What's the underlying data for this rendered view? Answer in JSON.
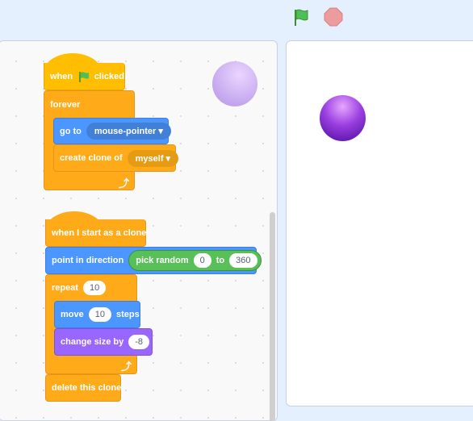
{
  "toolbar": {
    "green_flag": "green-flag-icon",
    "stop": "stop-icon"
  },
  "script1": {
    "hat_when": "when",
    "hat_clicked": "clicked",
    "forever": "forever",
    "goto": "go to",
    "goto_target": "mouse-pointer",
    "create_clone": "create clone of",
    "clone_target": "myself"
  },
  "script2": {
    "hat": "when I start as a clone",
    "point": "point in direction",
    "pick_random": "pick random",
    "from": "0",
    "to_label": "to",
    "to": "360",
    "repeat": "repeat",
    "repeat_count": "10",
    "move": "move",
    "move_steps": "10",
    "steps": "steps",
    "change_size": "change size by",
    "size_delta": "-8",
    "delete": "delete this clone"
  },
  "colors": {
    "events": "#ffbf00",
    "control": "#ffab19",
    "motion": "#4c97ff",
    "looks": "#9966ff",
    "operators": "#59c059",
    "sprite": "#8a2be2"
  }
}
